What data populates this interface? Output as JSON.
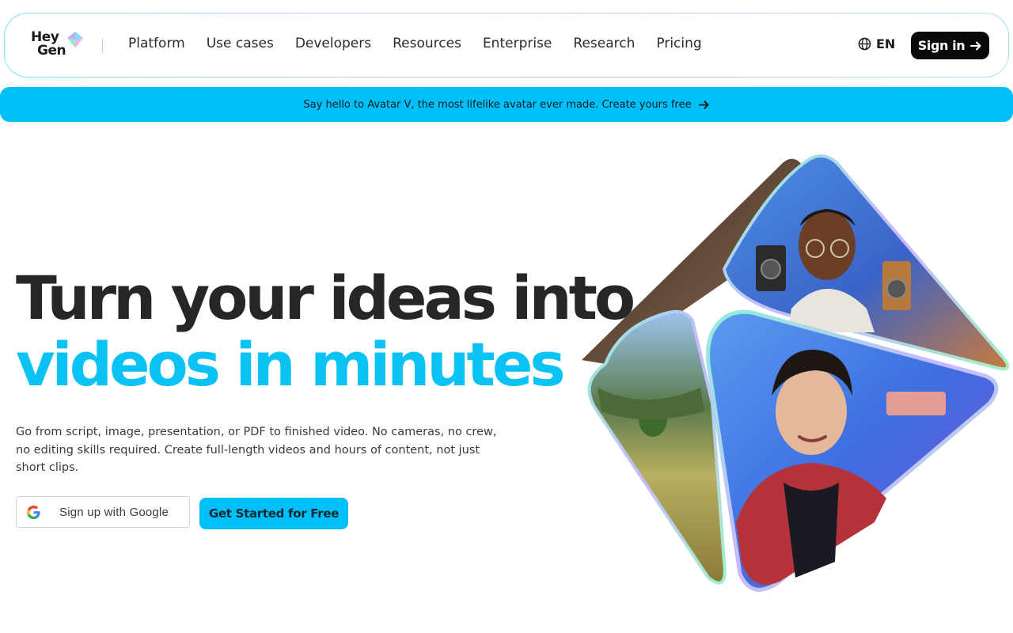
{
  "brand": {
    "logo_line1": "Hey",
    "logo_line2": "Gen"
  },
  "nav": {
    "links": [
      "Platform",
      "Use cases",
      "Developers",
      "Resources",
      "Enterprise",
      "Research",
      "Pricing"
    ],
    "language": "EN",
    "signin_label": "Sign in",
    "icons": {
      "language": "globe-icon",
      "signin": "arrow-right-icon"
    }
  },
  "banner": {
    "text": "Say hello to Avatar V, the most lifelike avatar ever made. Create yours free",
    "icon": "arrow-right-icon"
  },
  "hero": {
    "headline_line1": "Turn your ideas into",
    "headline_line2": "videos in minutes",
    "subtext": "Go from script, image, presentation, or PDF to finished video. No cameras, no crew, no editing skills required. Create full-length videos and hours of content, not just short clips.",
    "google_button": "Sign up with Google",
    "cta_button": "Get Started for Free"
  },
  "colors": {
    "accent": "#00c0f7",
    "headline_dark": "#262626",
    "headline_accent": "#0ac3f4",
    "signin_bg": "#0a0a0a"
  }
}
